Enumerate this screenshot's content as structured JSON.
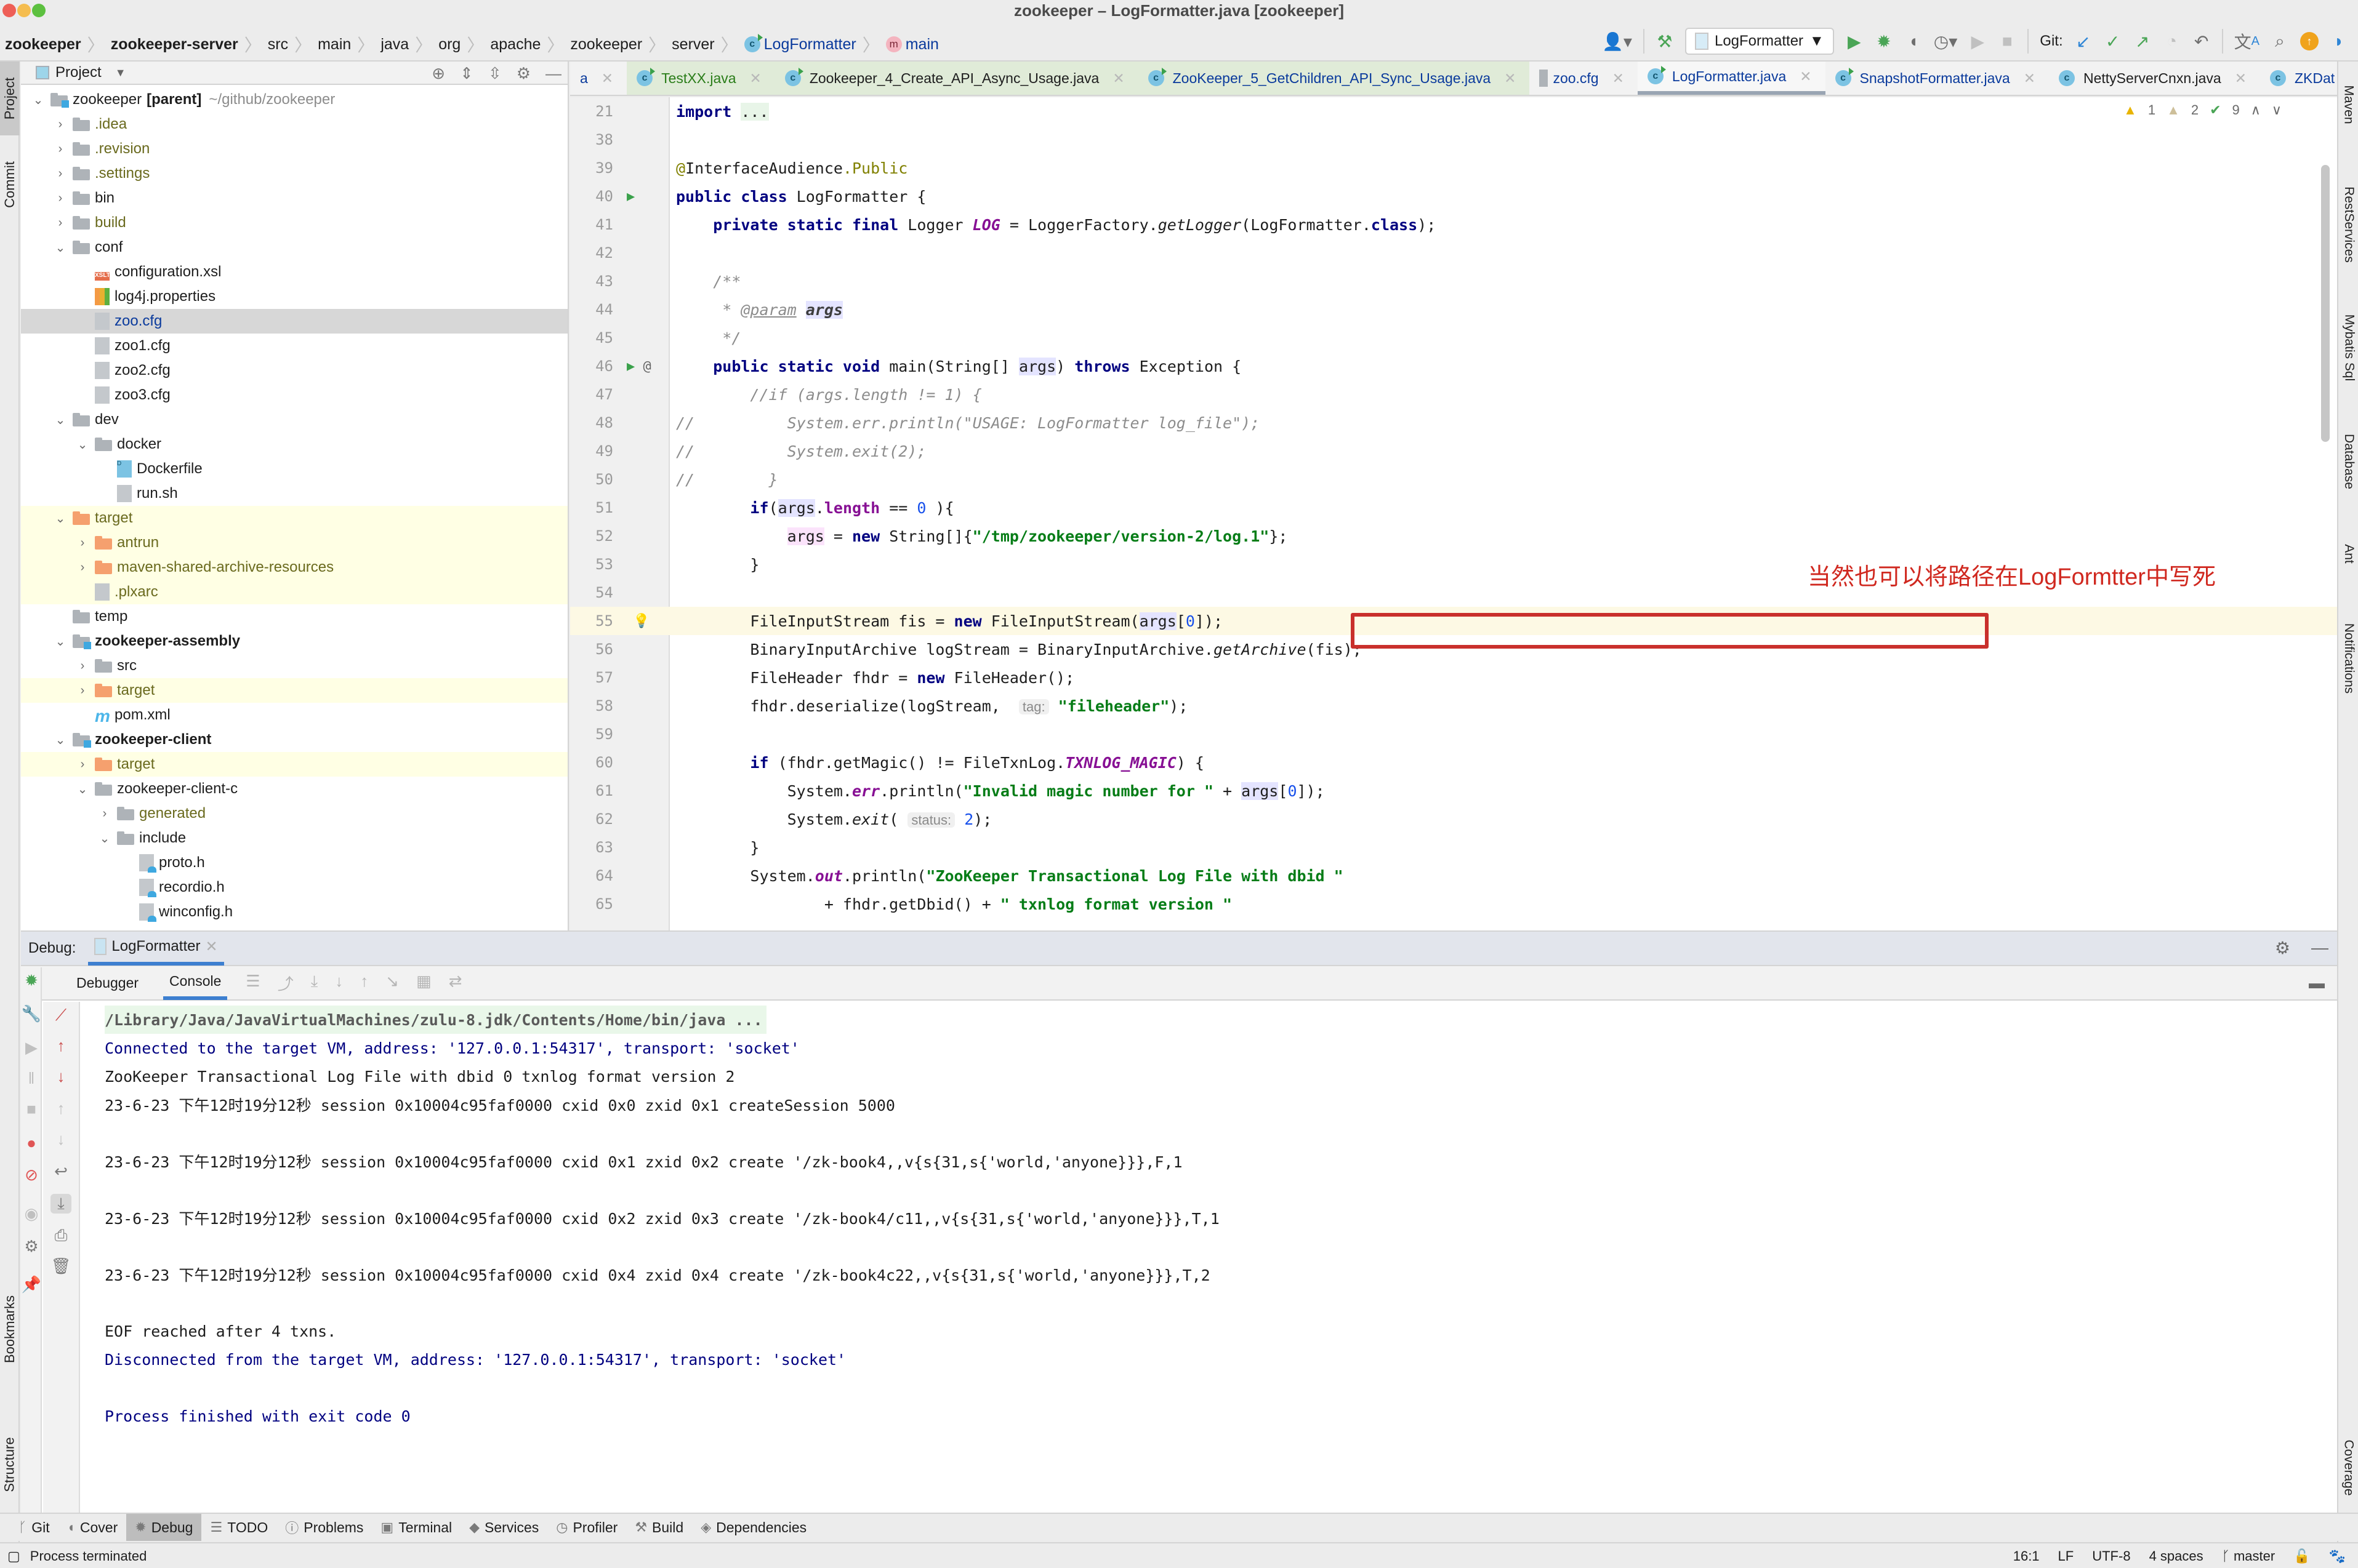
{
  "window": {
    "title": "zookeeper – LogFormatter.java [zookeeper]"
  },
  "breadcrumb": [
    {
      "label": "zookeeper",
      "bold": true
    },
    {
      "label": "zookeeper-server",
      "bold": true
    },
    {
      "label": "src"
    },
    {
      "label": "main"
    },
    {
      "label": "java"
    },
    {
      "label": "org"
    },
    {
      "label": "apache"
    },
    {
      "label": "zookeeper"
    },
    {
      "label": "server"
    },
    {
      "label": "LogFormatter",
      "icon": "class-icon"
    },
    {
      "label": "main",
      "icon": "method-icon"
    }
  ],
  "toolbar": {
    "run_config": "LogFormatter",
    "git_label": "Git:"
  },
  "left_strip": {
    "project": "Project",
    "commit": "Commit",
    "bookmarks": "Bookmarks",
    "structure": "Structure"
  },
  "project_panel": {
    "title": "Project",
    "tree": [
      {
        "label": "zookeeper",
        "extra": "[parent]",
        "path": "~/github/zookeeper",
        "type": "module",
        "level": 0,
        "expanded": true
      },
      {
        "label": ".idea",
        "type": "folder",
        "level": 1,
        "expanded": false,
        "color": "olive"
      },
      {
        "label": ".revision",
        "type": "folder",
        "level": 1,
        "expanded": false,
        "color": "olive"
      },
      {
        "label": ".settings",
        "type": "folder",
        "level": 1,
        "expanded": false,
        "color": "olive"
      },
      {
        "label": "bin",
        "type": "folder",
        "level": 1,
        "expanded": false
      },
      {
        "label": "build",
        "type": "folder",
        "level": 1,
        "expanded": false,
        "color": "olive"
      },
      {
        "label": "conf",
        "type": "folder",
        "level": 1,
        "expanded": true
      },
      {
        "label": "configuration.xsl",
        "type": "xslt",
        "level": 2
      },
      {
        "label": "log4j.properties",
        "type": "props",
        "level": 2
      },
      {
        "label": "zoo.cfg",
        "type": "cfg",
        "level": 2,
        "selected": true,
        "color": "blue"
      },
      {
        "label": "zoo1.cfg",
        "type": "cfg",
        "level": 2
      },
      {
        "label": "zoo2.cfg",
        "type": "cfg",
        "level": 2
      },
      {
        "label": "zoo3.cfg",
        "type": "cfg",
        "level": 2
      },
      {
        "label": "dev",
        "type": "folder",
        "level": 1,
        "expanded": true
      },
      {
        "label": "docker",
        "type": "folder",
        "level": 2,
        "expanded": true
      },
      {
        "label": "Dockerfile",
        "type": "docker",
        "level": 3
      },
      {
        "label": "run.sh",
        "type": "sh",
        "level": 3
      },
      {
        "label": "target",
        "type": "folder-orange",
        "level": 1,
        "expanded": true,
        "excluded": true,
        "color": "olive"
      },
      {
        "label": "antrun",
        "type": "folder-orange",
        "level": 2,
        "expanded": false,
        "excluded": true,
        "color": "olive"
      },
      {
        "label": "maven-shared-archive-resources",
        "type": "folder-orange",
        "level": 2,
        "expanded": false,
        "excluded": true,
        "color": "olive"
      },
      {
        "label": ".plxarc",
        "type": "cfg",
        "level": 2,
        "excluded": true,
        "color": "olive"
      },
      {
        "label": "temp",
        "type": "folder",
        "level": 1
      },
      {
        "label": "zookeeper-assembly",
        "type": "module",
        "level": 1,
        "expanded": true,
        "bold": true
      },
      {
        "label": "src",
        "type": "folder",
        "level": 2,
        "expanded": false
      },
      {
        "label": "target",
        "type": "folder-orange",
        "level": 2,
        "expanded": false,
        "excluded": true,
        "color": "olive"
      },
      {
        "label": "pom.xml",
        "type": "maven",
        "level": 2
      },
      {
        "label": "zookeeper-client",
        "type": "module",
        "level": 1,
        "expanded": true,
        "bold": true
      },
      {
        "label": "target",
        "type": "folder-orange",
        "level": 2,
        "expanded": false,
        "excluded": true,
        "color": "olive"
      },
      {
        "label": "zookeeper-client-c",
        "type": "folder",
        "level": 2,
        "expanded": true
      },
      {
        "label": "generated",
        "type": "folder",
        "level": 3,
        "expanded": false,
        "color": "olive"
      },
      {
        "label": "include",
        "type": "folder",
        "level": 3,
        "expanded": true
      },
      {
        "label": "proto.h",
        "type": "header",
        "level": 4
      },
      {
        "label": "recordio.h",
        "type": "header",
        "level": 4
      },
      {
        "label": "winconfig.h",
        "type": "header",
        "level": 4
      }
    ]
  },
  "editor_tabs": [
    {
      "label": "a",
      "style": "blue",
      "partial": true
    },
    {
      "label": "TestXX.java",
      "style": "green",
      "icon": "class-run",
      "tinted": true
    },
    {
      "label": "Zookeeper_4_Create_API_Async_Usage.java",
      "style": "dark",
      "icon": "class-run",
      "tinted": true
    },
    {
      "label": "ZooKeeper_5_GetChildren_API_Sync_Usage.java",
      "style": "blue",
      "icon": "class-run",
      "tinted": true
    },
    {
      "label": "zoo.cfg",
      "style": "blue",
      "icon": "cfg"
    },
    {
      "label": "LogFormatter.java",
      "style": "blue",
      "icon": "class-run",
      "active": true
    },
    {
      "label": "SnapshotFormatter.java",
      "style": "blue",
      "icon": "class-run"
    },
    {
      "label": "NettyServerCnxn.java",
      "style": "dark",
      "icon": "class"
    },
    {
      "label": "ZKDat",
      "style": "blue",
      "icon": "class",
      "partial": true
    }
  ],
  "inspections": {
    "warnings": "1",
    "weak_warnings": "2",
    "typos": "9"
  },
  "editor": {
    "annotation_text": "当然也可以将路径在LogFormtter中写死",
    "current_line": 55,
    "lines": [
      {
        "n": 21,
        "html": "<span class='kw'>import</span> <span style='background:#e8f5e8'>...</span>"
      },
      {
        "n": 38,
        "html": ""
      },
      {
        "n": 39,
        "html": "<span class='ann'>@</span>InterfaceAudience<span class='ann'>.Public</span>"
      },
      {
        "n": 40,
        "html": "<span class='kw'>public class</span> LogFormatter {",
        "mark": "run"
      },
      {
        "n": 41,
        "html": "    <span class='kw'>private static final</span> Logger <span class='fld'>LOG</span> = LoggerFactory.<span class='ital'>getLogger</span>(LogFormatter.<span class='kw'>class</span>);"
      },
      {
        "n": 42,
        "html": ""
      },
      {
        "n": 43,
        "html": "    <span class='cmt'>/**</span>"
      },
      {
        "n": 44,
        "html": "    <span class='cmt'> * <u>@param</u></span> <span class='hl' style='color:#3d3d3d;font-weight:bold;font-style:italic'>args</span>"
      },
      {
        "n": 45,
        "html": "    <span class='cmt'> */</span>"
      },
      {
        "n": 46,
        "html": "    <span class='kw'>public static void</span> main(String[] <span class='hl'>args</span>) <span class='kw'>throws</span> Exception {",
        "mark": "run-at"
      },
      {
        "n": 47,
        "html": "        <span class='cmt'>//if (args.length != 1) {</span>"
      },
      {
        "n": 48,
        "html": "<span class='cmt'>//          System.err.println(\"USAGE: LogFormatter log_file\");</span>",
        "indent": "left"
      },
      {
        "n": 49,
        "html": "<span class='cmt'>//          System.exit(2);</span>",
        "indent": "left"
      },
      {
        "n": 50,
        "html": "<span class='cmt'>//        }</span>",
        "indent": "left"
      },
      {
        "n": 51,
        "html": "        <span class='kw'>if</span>(<span class='hl'>args</span>.<span class='fld' style='font-style:normal'>length</span> == <span class='num'>0</span> ){"
      },
      {
        "n": 52,
        "html": "            <span style='background:#fbe3fb'>args</span> = <span class='kw'>new</span> String[]{<span class='str'>\"/tmp/zookeeper/version-2/log.1\"</span>};"
      },
      {
        "n": 53,
        "html": "        }"
      },
      {
        "n": 54,
        "html": ""
      },
      {
        "n": 55,
        "html": "        FileInputStream fis = <span class='kw'>new</span> FileInputStream(<span class='hl'>args</span>[<span class='num'>0</span>]);",
        "mark": "bulb"
      },
      {
        "n": 56,
        "html": "        BinaryInputArchive logStream = BinaryInputArchive.<span class='ital'>getArchive</span>(fis);"
      },
      {
        "n": 57,
        "html": "        FileHeader fhdr = <span class='kw'>new</span> FileHeader();"
      },
      {
        "n": 58,
        "html": "        fhdr.deserialize(logStream,  <span class='hint'>tag:</span> <span class='str'>\"fileheader\"</span>);"
      },
      {
        "n": 59,
        "html": ""
      },
      {
        "n": 60,
        "html": "        <span class='kw'>if</span> (fhdr.getMagic() != FileTxnLog.<span class='fld'>TXNLOG_MAGIC</span>) {"
      },
      {
        "n": 61,
        "html": "            System.<span class='fld'>err</span>.println(<span class='str'>\"Invalid magic number for \"</span> + <span class='hl'>args</span>[<span class='num'>0</span>]);"
      },
      {
        "n": 62,
        "html": "            System.<span class='ital'>exit</span>( <span class='hint'>status:</span> <span class='num'>2</span>);"
      },
      {
        "n": 63,
        "html": "        }"
      },
      {
        "n": 64,
        "html": "        System.<span class='fld'>out</span>.println(<span class='str'>\"ZooKeeper Transactional Log File with dbid \"</span>"
      },
      {
        "n": 65,
        "html": "                + fhdr.getDbid() + <span class='str'>\" txnlog format version \"</span>"
      }
    ]
  },
  "right_strip": [
    "Maven",
    "RestServices",
    "Mybatis Sql",
    "Database",
    "Ant",
    "Notifications",
    "Coverage"
  ],
  "debug": {
    "label": "Debug:",
    "session_tab": "LogFormatter",
    "subtabs": {
      "debugger": "Debugger",
      "console": "Console"
    },
    "console_lines": [
      {
        "kind": "cmd",
        "text": "/Library/Java/JavaVirtualMachines/zulu-8.jdk/Contents/Home/bin/java ..."
      },
      {
        "kind": "sys",
        "text": "Connected to the target VM, address: '127.0.0.1:54317', transport: 'socket'"
      },
      {
        "kind": "out",
        "text": "ZooKeeper Transactional Log File with dbid 0 txnlog format version 2"
      },
      {
        "kind": "out",
        "text": "23-6-23 下午12时19分12秒 session 0x10004c95faf0000 cxid 0x0 zxid 0x1 createSession 5000"
      },
      {
        "kind": "out",
        "text": ""
      },
      {
        "kind": "out",
        "text": "23-6-23 下午12时19分12秒 session 0x10004c95faf0000 cxid 0x1 zxid 0x2 create '/zk-book4,,v{s{31,s{'world,'anyone}}},F,1"
      },
      {
        "kind": "out",
        "text": ""
      },
      {
        "kind": "out",
        "text": "23-6-23 下午12时19分12秒 session 0x10004c95faf0000 cxid 0x2 zxid 0x3 create '/zk-book4/c11,,v{s{31,s{'world,'anyone}}},T,1"
      },
      {
        "kind": "out",
        "text": ""
      },
      {
        "kind": "out",
        "text": "23-6-23 下午12时19分12秒 session 0x10004c95faf0000 cxid 0x4 zxid 0x4 create '/zk-book4c22,,v{s{31,s{'world,'anyone}}},T,2"
      },
      {
        "kind": "out",
        "text": ""
      },
      {
        "kind": "out",
        "text": "EOF reached after 4 txns."
      },
      {
        "kind": "sys",
        "text": "Disconnected from the target VM, address: '127.0.0.1:54317', transport: 'socket'"
      },
      {
        "kind": "out",
        "text": ""
      },
      {
        "kind": "sys",
        "text": "Process finished with exit code 0"
      }
    ]
  },
  "bottom_tabs": [
    {
      "label": "Git",
      "icon": "ᚴ"
    },
    {
      "label": "Cover",
      "icon": "◖"
    },
    {
      "label": "Debug",
      "icon": "✹",
      "active": true
    },
    {
      "label": "TODO",
      "icon": "☰"
    },
    {
      "label": "Problems",
      "icon": "ⓘ"
    },
    {
      "label": "Terminal",
      "icon": "▣"
    },
    {
      "label": "Services",
      "icon": "◆"
    },
    {
      "label": "Profiler",
      "icon": "◷"
    },
    {
      "label": "Build",
      "icon": "⚒"
    },
    {
      "label": "Dependencies",
      "icon": "◈"
    }
  ],
  "status": {
    "message": "Process terminated",
    "position": "16:1",
    "line_sep": "LF",
    "encoding": "UTF-8",
    "indent": "4 spaces",
    "branch": "master"
  }
}
